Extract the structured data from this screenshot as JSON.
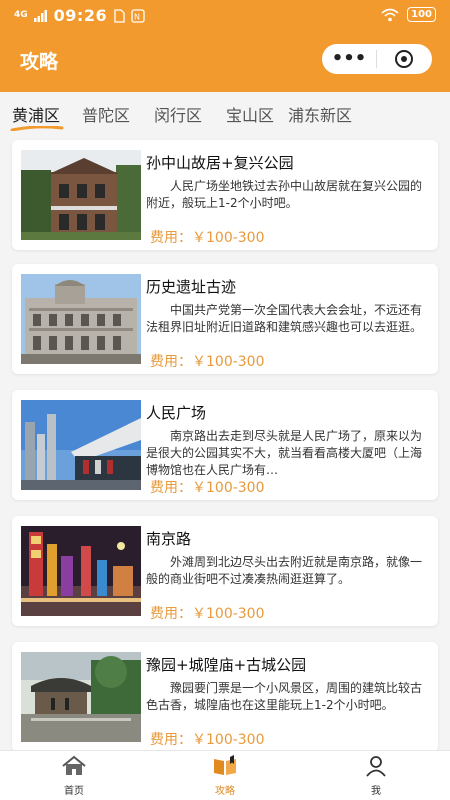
{
  "status_bar": {
    "signal": "4G",
    "time": "09:26",
    "battery": "100"
  },
  "header": {
    "title": "攻略",
    "more_icon": "more-dots-icon",
    "close_icon": "close-circle-icon"
  },
  "tabs": [
    {
      "label": "黄浦区",
      "active": true
    },
    {
      "label": "普陀区",
      "active": false
    },
    {
      "label": "闵行区",
      "active": false
    },
    {
      "label": "宝山区",
      "active": false
    },
    {
      "label": "浦东新区",
      "active": false
    }
  ],
  "cards": [
    {
      "title": "孙中山故居+复兴公园",
      "desc": "人民广场坐地铁过去孙中山故居就在复兴公园的附近，般玩上1-2个小时吧。",
      "price": "费用：￥100-300"
    },
    {
      "title": "历史遗址古迹",
      "desc": "中国共产党第一次全国代表大会会址，不远还有法租界旧址附近旧道路和建筑感兴趣也可以去逛逛。",
      "price": "费用：￥100-300"
    },
    {
      "title": "人民广场",
      "desc": "南京路出去走到尽头就是人民广场了，原来以为是很大的公园其实不大，就当看看高楼大厦吧（上海博物馆也在人民广场有…",
      "price": "费用：￥100-300"
    },
    {
      "title": "南京路",
      "desc": "外滩周到北边尽头出去附近就是南京路，就像一般的商业街吧不过凑凑热闹逛逛算了。",
      "price": "费用：￥100-300"
    },
    {
      "title": "豫园+城隍庙+古城公园",
      "desc": "豫园要门票是一个小风景区，周围的建筑比较古色古香，城隍庙也在这里能玩上1-2个小时吧。",
      "price": "费用：￥100-300"
    }
  ],
  "bottom_nav": [
    {
      "label": "首页",
      "icon": "home-icon",
      "active": false
    },
    {
      "label": "攻略",
      "icon": "book-icon",
      "active": true
    },
    {
      "label": "我",
      "icon": "user-icon",
      "active": false
    }
  ],
  "colors": {
    "accent": "#f39a2e",
    "price": "#e89a3c",
    "active_nav": "#e08a20"
  }
}
